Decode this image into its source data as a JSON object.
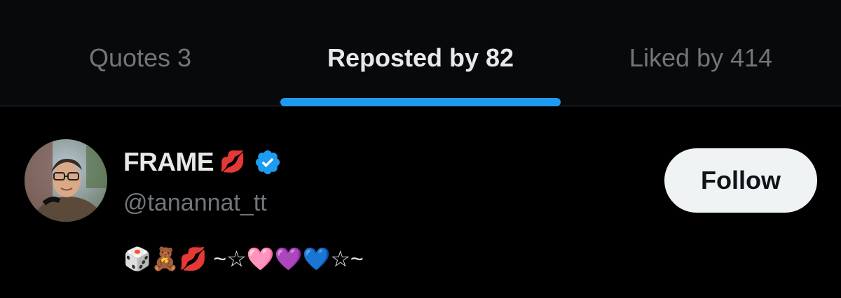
{
  "tabs": [
    {
      "label": "Quotes 3",
      "active": false
    },
    {
      "label": "Reposted by 82",
      "active": true
    },
    {
      "label": "Liked by 414",
      "active": false
    }
  ],
  "user": {
    "display_name": "FRAME",
    "name_emoji": "💋",
    "verified": true,
    "handle": "@tanannat_tt",
    "bio": "🎲🧸💋 ~☆🩷💜💙☆~"
  },
  "follow_button": {
    "label": "Follow"
  },
  "colors": {
    "accent": "#1d9bf0",
    "background": "#000000",
    "secondary_text": "#71767b",
    "primary_text": "#e7e9ea",
    "button_bg": "#eff3f4"
  },
  "icons": {
    "verified": "verified-badge-icon",
    "avatar": "profile-photo"
  }
}
